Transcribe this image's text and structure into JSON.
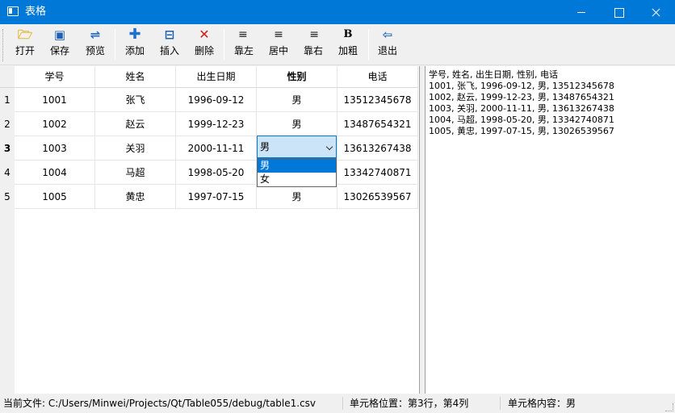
{
  "window": {
    "title": "表格"
  },
  "toolbar": {
    "buttons": [
      {
        "icon": "folder-open-icon",
        "glyph": "🗁",
        "label": "打开"
      },
      {
        "icon": "floppy-save-icon",
        "glyph": "▣",
        "label": "保存"
      },
      {
        "icon": "preview-icon",
        "glyph": "⇌",
        "label": "预览"
      },
      {
        "icon": "add-icon",
        "glyph": "✚",
        "label": "添加"
      },
      {
        "icon": "insert-row-icon",
        "glyph": "⊟",
        "label": "插入"
      },
      {
        "icon": "delete-icon",
        "glyph": "✕",
        "label": "删除"
      },
      {
        "icon": "align-left-icon",
        "glyph": "≡",
        "label": "靠左"
      },
      {
        "icon": "align-center-icon",
        "glyph": "≡",
        "label": "居中"
      },
      {
        "icon": "align-right-icon",
        "glyph": "≡",
        "label": "靠右"
      },
      {
        "icon": "bold-icon",
        "glyph": "B",
        "label": "加粗"
      },
      {
        "icon": "exit-icon",
        "glyph": "⇦",
        "label": "退出"
      }
    ]
  },
  "table": {
    "headers": [
      "学号",
      "姓名",
      "出生日期",
      "性别",
      "电话"
    ],
    "bold_header_index": 3,
    "row_numbers": [
      "1",
      "2",
      "3",
      "4",
      "5"
    ],
    "current_row_index": 2,
    "rows": [
      [
        "1001",
        "张飞",
        "1996-09-12",
        "男",
        "13512345678"
      ],
      [
        "1002",
        "赵云",
        "1999-12-23",
        "男",
        "13487654321"
      ],
      [
        "1003",
        "关羽",
        "2000-11-11",
        "男",
        "13613267438"
      ],
      [
        "1004",
        "马超",
        "1998-05-20",
        "",
        "13342740871"
      ],
      [
        "1005",
        "黄忠",
        "1997-07-15",
        "男",
        "13026539567"
      ]
    ],
    "editor": {
      "value": "男",
      "options": [
        "男",
        "女"
      ],
      "selected_index": 0
    }
  },
  "text_panel": {
    "lines": [
      "学号, 姓名, 出生日期, 性别, 电话",
      "1001, 张飞, 1996-09-12, 男, 13512345678",
      "1002, 赵云, 1999-12-23, 男, 13487654321",
      "1003, 关羽, 2000-11-11, 男, 13613267438",
      "1004, 马超, 1998-05-20, 男, 13342740871",
      "1005, 黄忠, 1997-07-15, 男, 13026539567"
    ]
  },
  "status": {
    "file": "当前文件:  C:/Users/Minwei/Projects/Qt/Table055/debug/table1.csv",
    "position": "单元格位置：第3行，第4列",
    "content": "单元格内容：男"
  },
  "colors": {
    "titlebar": "#0078d7",
    "selection": "#0078d7",
    "editor_bg": "#cce4f7"
  }
}
